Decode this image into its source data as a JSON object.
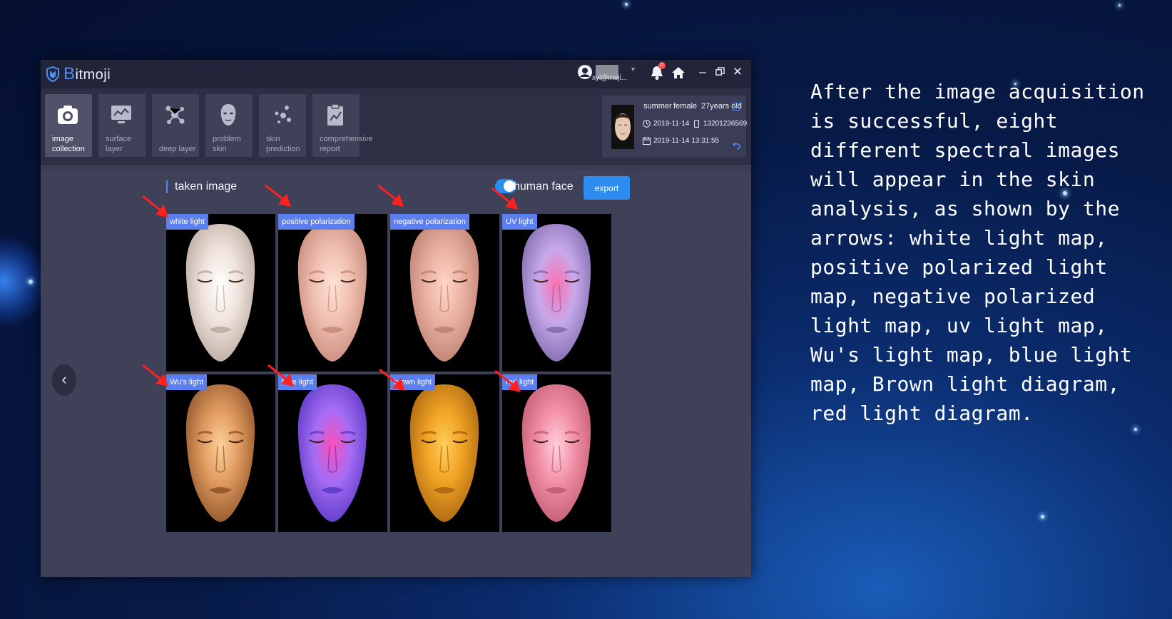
{
  "app": {
    "name_initial": "B",
    "name_rest": "itmoji"
  },
  "user": {
    "name": "xyl@moji..."
  },
  "notifications": {
    "count": "0"
  },
  "toolbar": {
    "items": [
      {
        "label": "image collection",
        "active": true
      },
      {
        "label": "surface layer",
        "active": false
      },
      {
        "label": "deep layer",
        "active": false
      },
      {
        "label": "problem skin",
        "active": false
      },
      {
        "label": "skin prediction",
        "active": false
      },
      {
        "label": "comprehensive report",
        "active": false
      }
    ]
  },
  "profile": {
    "name": "summer",
    "gender": "female",
    "age": "27years old",
    "date": "2019-11-14",
    "phone": "13201236569",
    "datetime": "2019-11-14 13:31:55"
  },
  "content": {
    "section_title": "taken image",
    "toggle_label": "human face",
    "export_label": "export",
    "prev_label": "‹"
  },
  "images": [
    {
      "label": "white light",
      "skin": "#efe3dc",
      "shade": "#b9a89f",
      "glow": "#ffffff"
    },
    {
      "label": "positive polarization",
      "skin": "#f0c0b0",
      "shade": "#c78a7c",
      "glow": "#ffe2d8"
    },
    {
      "label": "negative polarization",
      "skin": "#eab2a2",
      "shade": "#bd7f70",
      "glow": "#ffd6c8"
    },
    {
      "label": "UV light",
      "skin": "#c7a9ea",
      "shade": "#7e6aac",
      "glow": "#ff6fb0"
    },
    {
      "label": "Wu's light",
      "skin": "#e09a60",
      "shade": "#8d5428",
      "glow": "#ffd09a"
    },
    {
      "label": "blue light",
      "skin": "#a56df5",
      "shade": "#5b38c4",
      "glow": "#ff4fb8"
    },
    {
      "label": "brown light",
      "skin": "#f0a224",
      "shade": "#a86410",
      "glow": "#ffcf5a"
    },
    {
      "label": "red light",
      "skin": "#f290a8",
      "shade": "#c05a72",
      "glow": "#ffd0dc"
    }
  ],
  "colors": {
    "accent": "#2d8cf0",
    "label_bg": "#5c7ff0",
    "arrow": "#ff2020"
  },
  "description": "After the image acquisition is successful, eight different spectral images will appear in the skin analysis, as shown by the arrows: white light map, positive polarized light map, negative polarized light map, uv light map, Wu's light map, blue light map, Brown light diagram, red light diagram."
}
